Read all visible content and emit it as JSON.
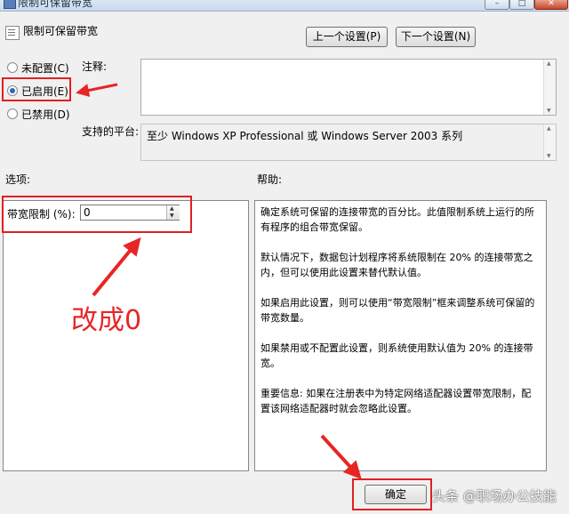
{
  "window": {
    "title": "限制可保留带宽",
    "buttons": {
      "minimize": "–",
      "maximize": "□",
      "close": "✕"
    }
  },
  "policy": {
    "title": "限制可保留带宽",
    "prev_label": "上一个设置(P)",
    "next_label": "下一个设置(N)"
  },
  "state": {
    "options": [
      {
        "label": "未配置(C)",
        "selected": false
      },
      {
        "label": "已启用(E)",
        "selected": true
      },
      {
        "label": "已禁用(D)",
        "selected": false
      }
    ]
  },
  "comment": {
    "label": "注释:",
    "value": ""
  },
  "platform": {
    "label": "支持的平台:",
    "value": "至少 Windows XP Professional 或 Windows Server 2003 系列"
  },
  "options_panel": {
    "header": "选项:",
    "bandwidth_label": "带宽限制 (%):",
    "bandwidth_value": "0"
  },
  "help_panel": {
    "header": "帮助:",
    "paragraphs": [
      "确定系统可保留的连接带宽的百分比。此值限制系统上运行的所有程序的组合带宽保留。",
      "默认情况下，数据包计划程序将系统限制在 20% 的连接带宽之内，但可以使用此设置来替代默认值。",
      "如果启用此设置，则可以使用“带宽限制”框来调整系统可保留的带宽数量。",
      "如果禁用或不配置此设置，则系统使用默认值为 20% 的连接带宽。",
      "重要信息: 如果在注册表中为特定网络适配器设置带宽限制，配置该网络适配器时就会忽略此设置。"
    ]
  },
  "footer": {
    "ok_label": "确定",
    "cancel_label": ""
  },
  "annotations": {
    "note": "改成0",
    "color": "#e82525"
  },
  "watermark": "头条 @职场办公技能"
}
